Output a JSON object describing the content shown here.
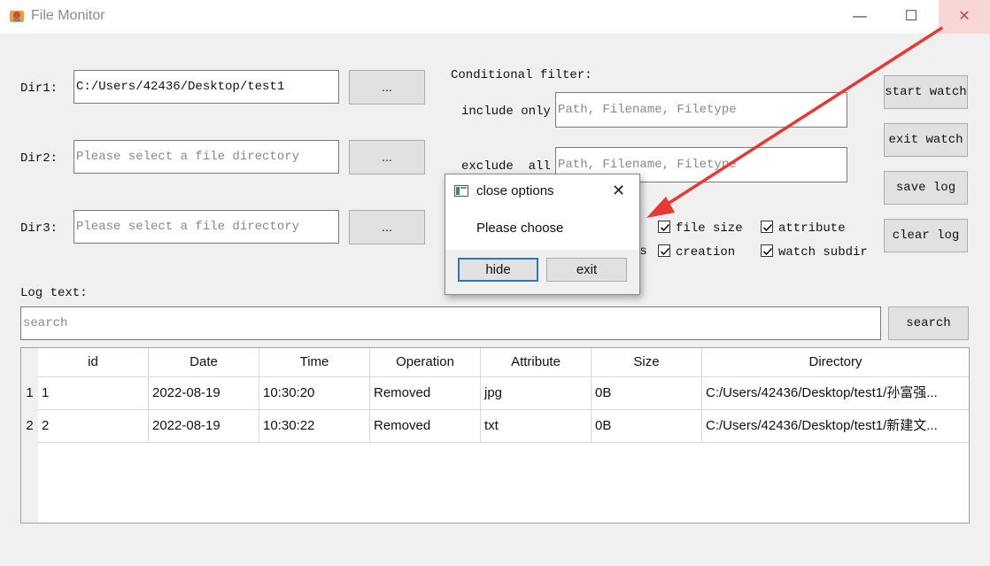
{
  "window": {
    "title": "File Monitor",
    "min_glyph": "—",
    "max_glyph": "☐",
    "close_glyph": "✕"
  },
  "dirs": [
    {
      "label": "Dir1:",
      "value": "C:/Users/42436/Desktop/test1",
      "placeholder": "Please select a file directory",
      "browse": "..."
    },
    {
      "label": "Dir2:",
      "value": "",
      "placeholder": "Please select a file directory",
      "browse": "..."
    },
    {
      "label": "Dir3:",
      "value": "",
      "placeholder": "Please select a file directory",
      "browse": "..."
    }
  ],
  "filter": {
    "title": "Conditional filter:",
    "include_label": "include only",
    "include_placeholder": "Path, Filename, Filetype",
    "exclude_label": "exclude  all",
    "exclude_placeholder": "Path, Filename, Filetype"
  },
  "checkboxes": {
    "partial_label": "ss",
    "file_size": "file size",
    "attribute": "attribute",
    "creation": "creation",
    "watch_subdir": "watch subdir"
  },
  "actions": {
    "start": "start watch",
    "exit": "exit watch",
    "save": "save log",
    "clear": "clear log"
  },
  "log": {
    "label": "Log text:",
    "search_placeholder": "search",
    "search_button": "search"
  },
  "table": {
    "headers": [
      "id",
      "Date",
      "Time",
      "Operation",
      "Attribute",
      "Size",
      "Directory"
    ],
    "rows": [
      {
        "num": "1",
        "cells": [
          "1",
          "2022-08-19",
          "10:30:20",
          "Removed",
          "jpg",
          "0B",
          "C:/Users/42436/Desktop/test1/孙富强..."
        ]
      },
      {
        "num": "2",
        "cells": [
          "2",
          "2022-08-19",
          "10:30:22",
          "Removed",
          "txt",
          "0B",
          "C:/Users/42436/Desktop/test1/新建文..."
        ]
      }
    ]
  },
  "dialog": {
    "title": "close options",
    "close_glyph": "✕",
    "message": "Please choose",
    "hide": "hide",
    "exit": "exit"
  },
  "colors": {
    "window_bg": "#f0f0f0",
    "arrow": "#e53935",
    "focus_border": "#2b77c7"
  }
}
